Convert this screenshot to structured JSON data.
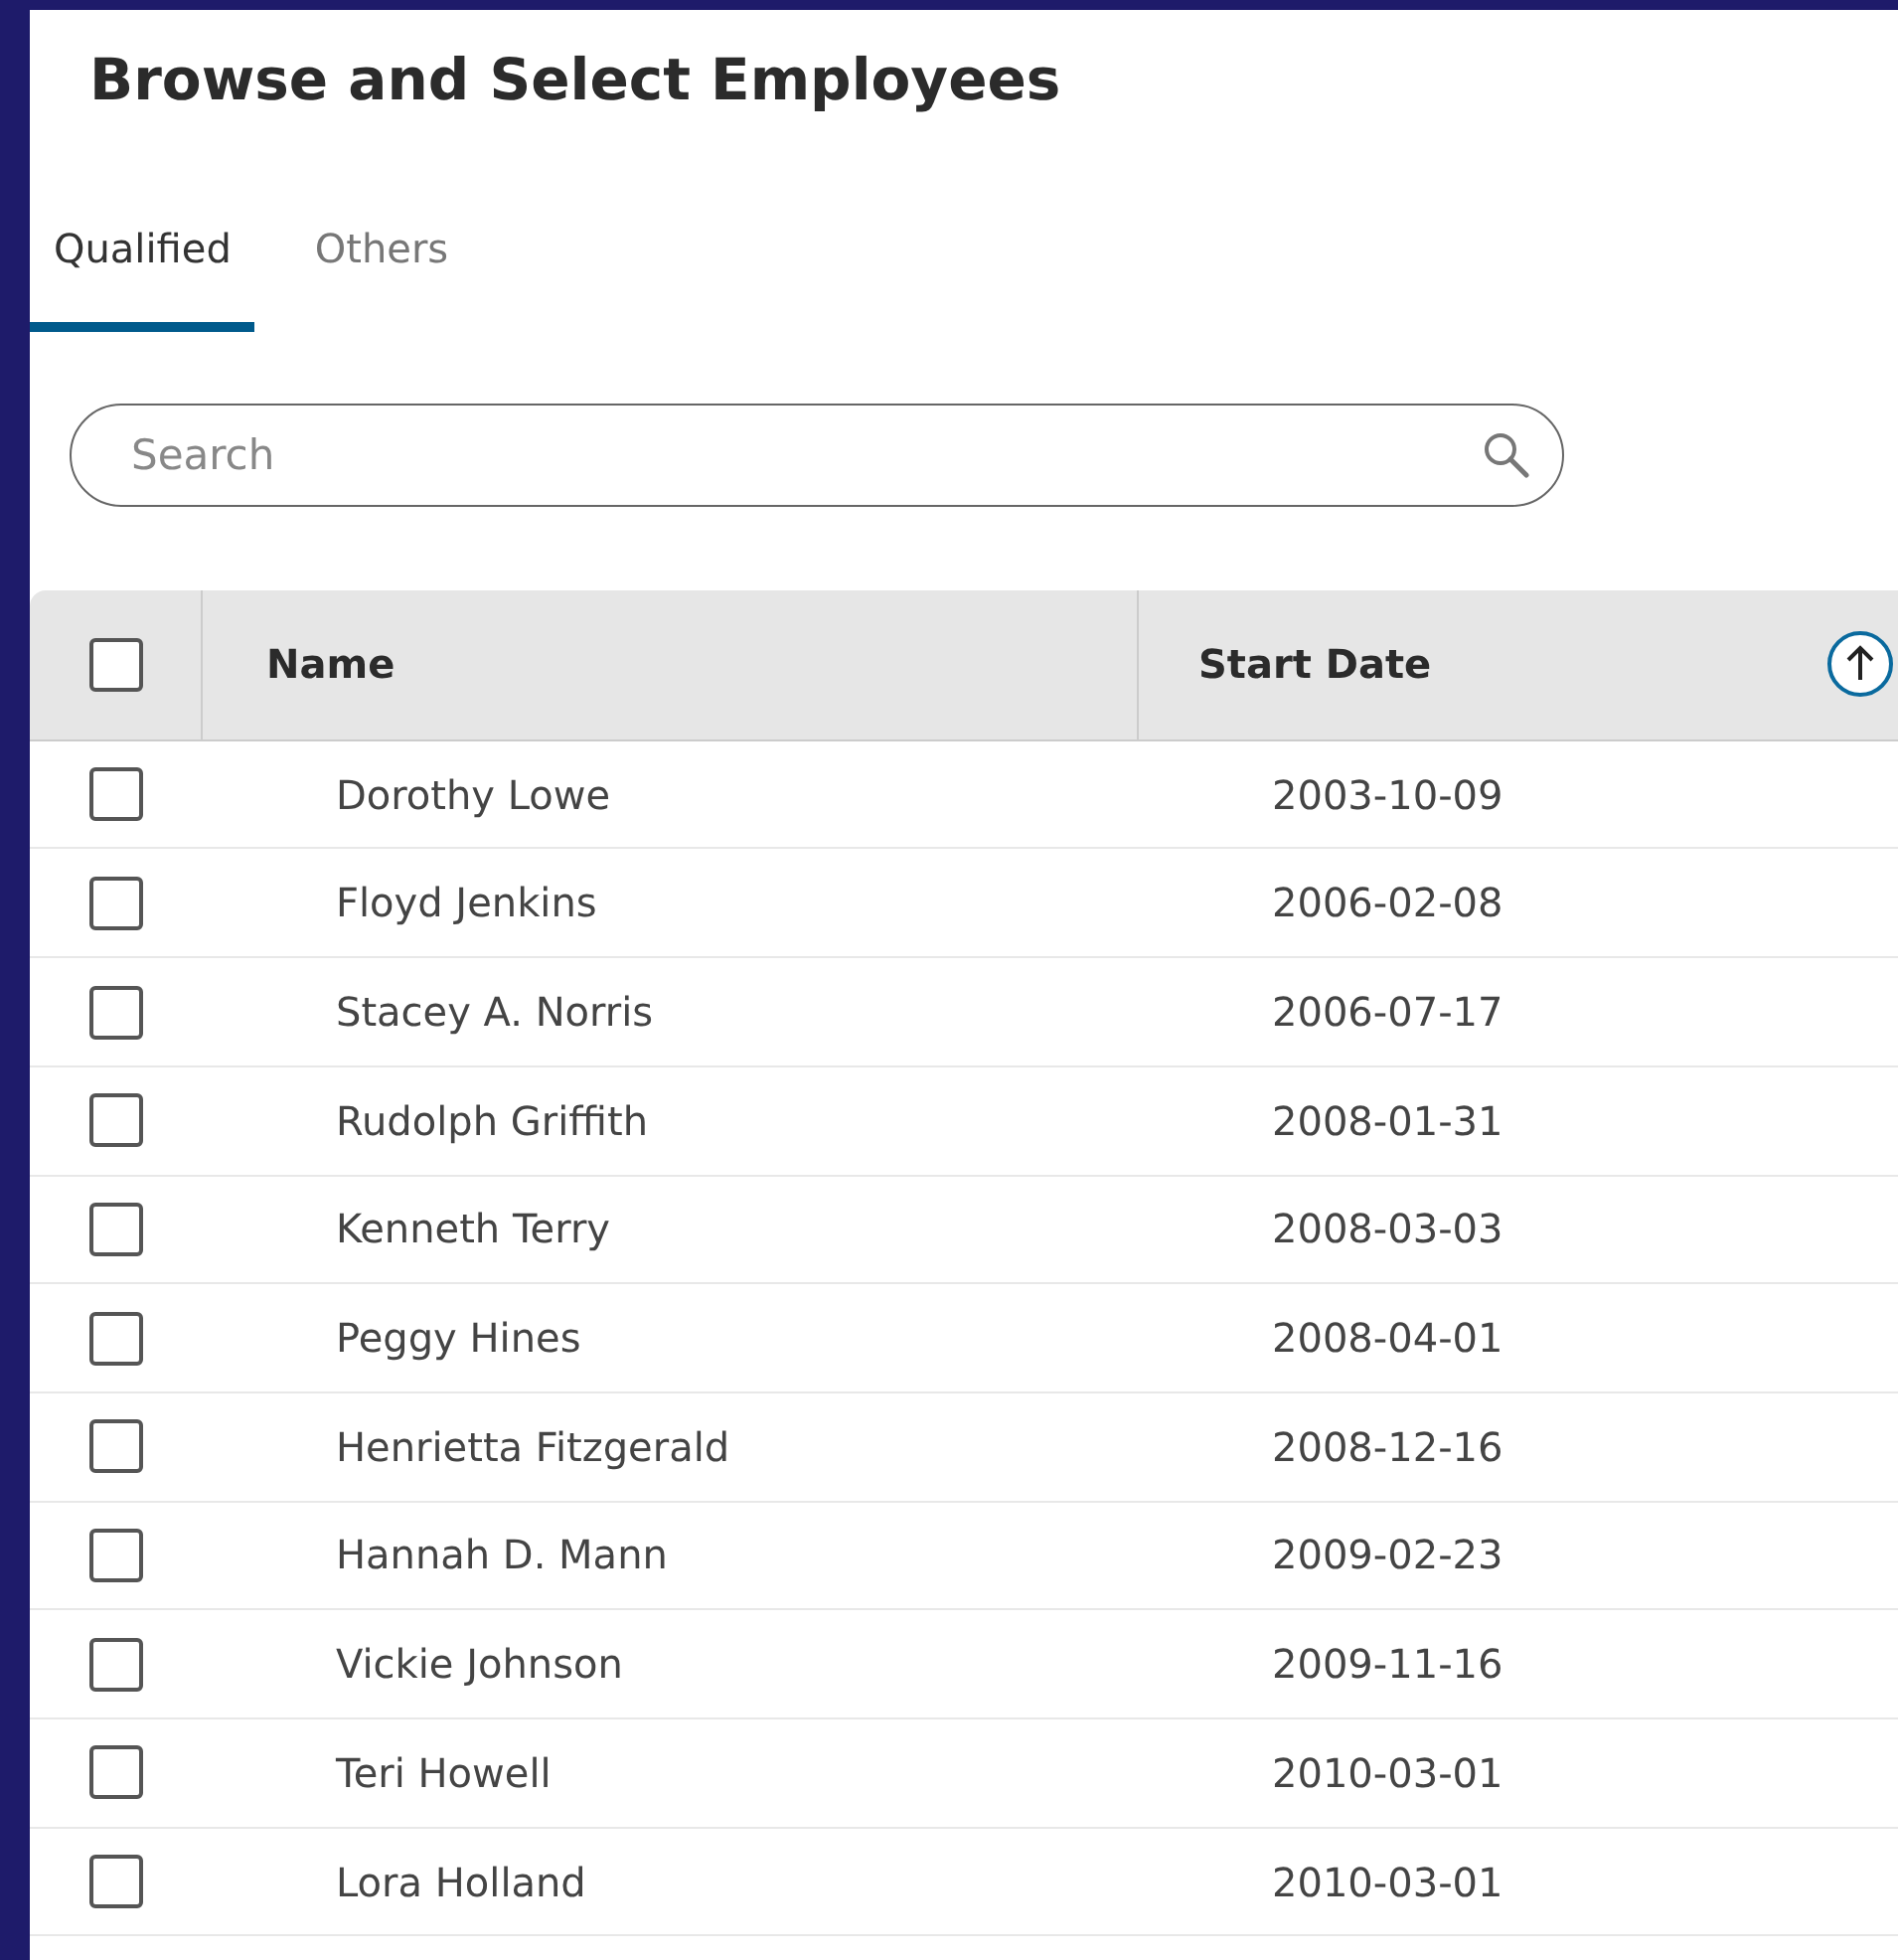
{
  "title": "Browse and Select Employees",
  "tabs": [
    {
      "label": "Qualified",
      "selected": true
    },
    {
      "label": "Others",
      "selected": false
    }
  ],
  "search": {
    "placeholder": "Search"
  },
  "table": {
    "select_all_checked": false,
    "columns": [
      {
        "label": "Name"
      },
      {
        "label": "Start Date",
        "sort_ascending": true
      }
    ],
    "rows": [
      {
        "checked": false,
        "name": "Dorothy Lowe",
        "start_date": "2003-10-09"
      },
      {
        "checked": false,
        "name": "Floyd Jenkins",
        "start_date": "2006-02-08"
      },
      {
        "checked": false,
        "name": "Stacey A. Norris",
        "start_date": "2006-07-17"
      },
      {
        "checked": false,
        "name": "Rudolph Griffith",
        "start_date": "2008-01-31"
      },
      {
        "checked": false,
        "name": "Kenneth Terry",
        "start_date": "2008-03-03"
      },
      {
        "checked": false,
        "name": "Peggy Hines",
        "start_date": "2008-04-01"
      },
      {
        "checked": false,
        "name": "Henrietta Fitzgerald",
        "start_date": "2008-12-16"
      },
      {
        "checked": false,
        "name": "Hannah D. Mann",
        "start_date": "2009-02-23"
      },
      {
        "checked": false,
        "name": "Vickie Johnson",
        "start_date": "2009-11-16"
      },
      {
        "checked": false,
        "name": "Teri Howell",
        "start_date": "2010-03-01"
      },
      {
        "checked": false,
        "name": "Lora Holland",
        "start_date": "2010-03-01"
      }
    ]
  }
}
